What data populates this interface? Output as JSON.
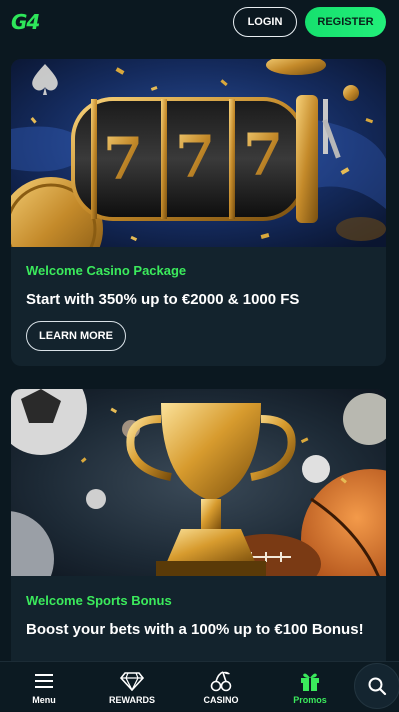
{
  "header": {
    "logo_text": "G4",
    "login_label": "LOGIN",
    "register_label": "REGISTER"
  },
  "promos": [
    {
      "kicker": "Welcome Casino Package",
      "title": "Start with 350% up to €2000 & 1000 FS",
      "button_label": "LEARN MORE",
      "image": "slot-machine-777"
    },
    {
      "kicker": "Welcome Sports Bonus",
      "title": "Boost your bets with a 100% up to €100 Bonus!",
      "image": "golden-trophy-sports-balls"
    }
  ],
  "bottom_nav": {
    "items": [
      {
        "label": "Menu",
        "icon": "hamburger-icon"
      },
      {
        "label": "REWARDS",
        "icon": "diamond-icon"
      },
      {
        "label": "CASINO",
        "icon": "cherries-icon"
      },
      {
        "label": "Promos",
        "icon": "gift-icon",
        "active": true
      }
    ],
    "search_icon": "search-icon"
  },
  "colors": {
    "background": "#0b1820",
    "card": "#13232d",
    "accent_green": "#3bea5c",
    "register_green": "#1ee874"
  }
}
